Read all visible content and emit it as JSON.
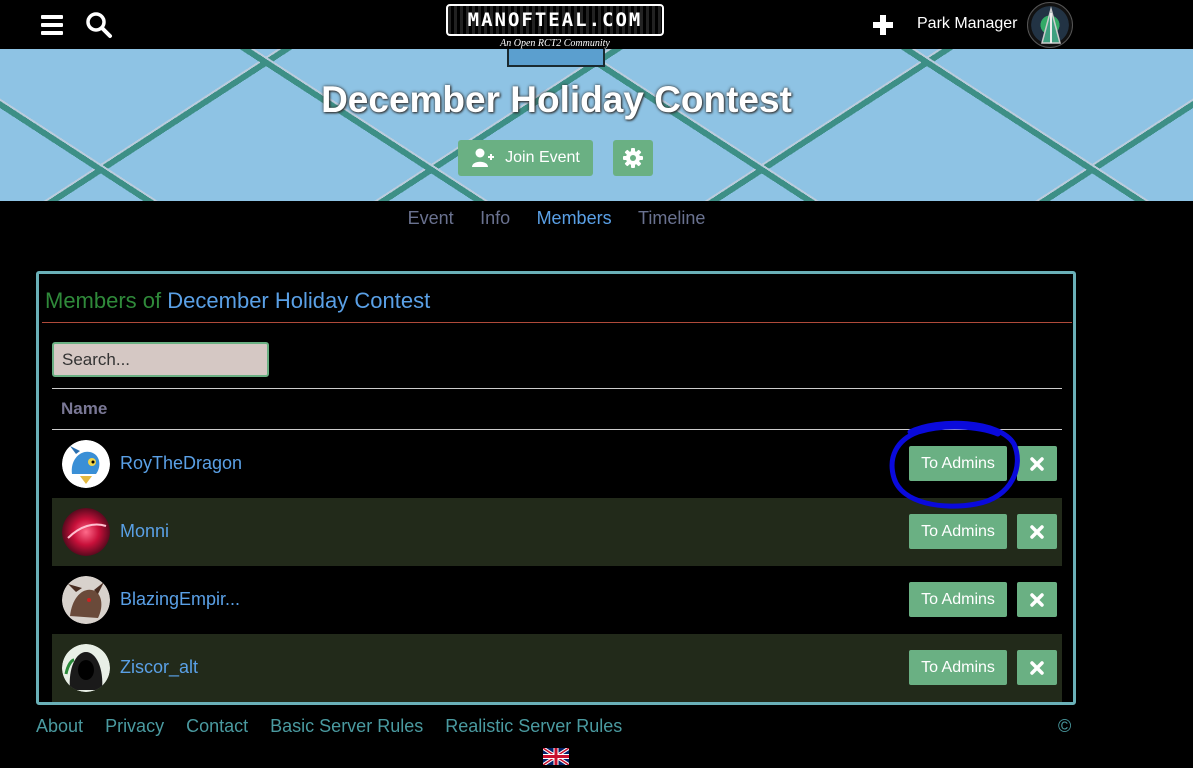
{
  "header": {
    "logo_text": "MANOFTEAL.COM",
    "logo_subtitle": "An Open RCT2 Community",
    "user_name": "Park Manager"
  },
  "event": {
    "title": "December Holiday Contest",
    "join_label": "Join Event"
  },
  "tabs": [
    {
      "label": "Event"
    },
    {
      "label": "Info"
    },
    {
      "label": "Members",
      "active": true
    },
    {
      "label": "Timeline"
    }
  ],
  "members_panel": {
    "title_prefix": "Members of",
    "title_event": "December Holiday Contest",
    "search_placeholder": "Search...",
    "column_name": "Name",
    "rows": [
      {
        "name": "RoyTheDragon",
        "action_label": "To Admins"
      },
      {
        "name": "Monni",
        "action_label": "To Admins"
      },
      {
        "name": "BlazingEmpir...",
        "action_label": "To Admins"
      },
      {
        "name": "Ziscor_alt",
        "action_label": "To Admins"
      }
    ]
  },
  "footer": {
    "links": [
      "About",
      "Privacy",
      "Contact",
      "Basic Server Rules",
      "Realistic Server Rules"
    ],
    "copyright": "©"
  },
  "colors": {
    "accent_green": "#6ab083",
    "link_blue": "#5aa0e6",
    "panel_border": "#6ab0b8",
    "annotation_circle": "#0a0adc"
  }
}
